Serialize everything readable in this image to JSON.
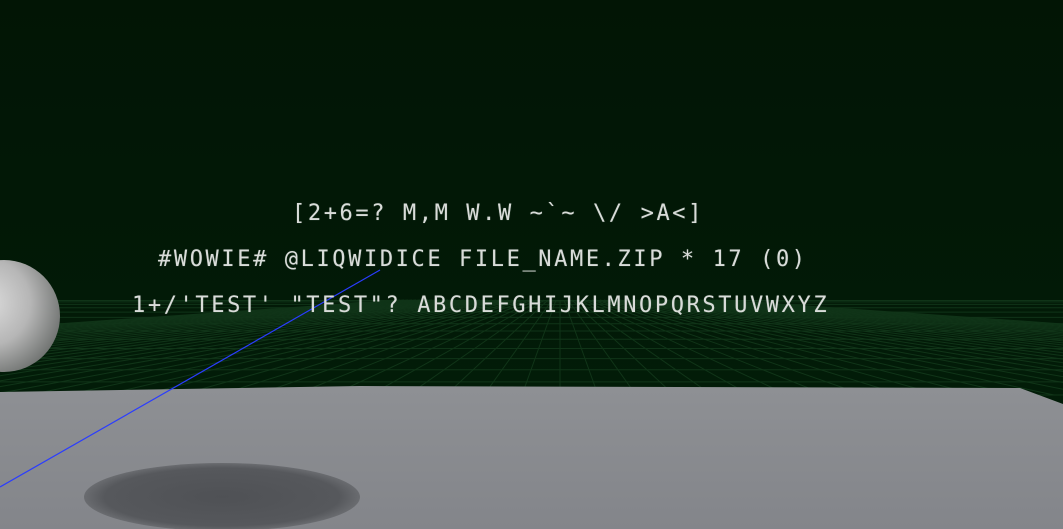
{
  "scene": {
    "background_color": "#021806",
    "floor_color": "#8a8c90",
    "grid_color": "#1c4a26",
    "axis_line_color": "#2a3cff",
    "sphere_color": "#bdbdbd"
  },
  "text_lines": [
    "[2+6=? M,M W.W ~`~ \\/ >A<]",
    "#WOWIE# @LIQWIDICE FILE_NAME.ZIP * 17 (0)",
    "1+/'TEST' \"TEST\"? ABCDEFGHIJKLMNOPQRSTUVWXYZ"
  ]
}
